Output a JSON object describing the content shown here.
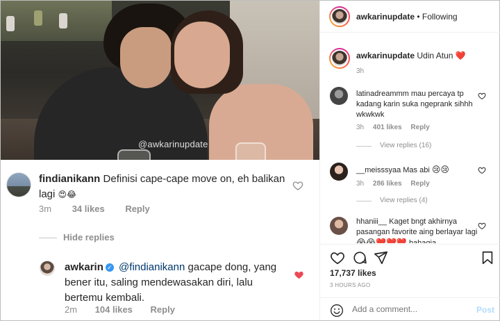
{
  "photo": {
    "watermark": "@awkarinupdate"
  },
  "zoom_comments": [
    {
      "username": "findianikann",
      "text": "Definisi cape-cape move on, eh balikan lagi",
      "emoji": "😍😂",
      "time": "3m",
      "likes": "34 likes",
      "reply": "Reply",
      "liked": false
    },
    {
      "username": "awkarin",
      "verified": true,
      "mention": "@findianikann",
      "text": "gacape dong, yang bener itu, saling mendewasakan diri, lalu bertemu kembali.",
      "time": "2m",
      "likes": "104 likes",
      "reply": "Reply",
      "liked": true
    }
  ],
  "hide_replies": "Hide replies",
  "post": {
    "account": "awkarinupdate",
    "follow_status": "• Following",
    "caption_user": "awkarinupdate",
    "caption": "Udin Atun",
    "caption_emoji": "❤️",
    "caption_time": "3h",
    "comments": [
      {
        "username": "latinadreammm",
        "text": "mau percaya tp kadang karin suka ngeprank sihhh wkwkwk",
        "time": "3h",
        "likes": "401 likes",
        "reply": "Reply",
        "view_replies": "View replies (16)"
      },
      {
        "username": "__meisssyaa",
        "text": "Mas abi",
        "emoji": "😢😢",
        "time": "3h",
        "likes": "286 likes",
        "reply": "Reply",
        "view_replies": "View replies (4)"
      },
      {
        "username": "hhaniii__",
        "text": "Kaget bngt akhirnya pasangan favorite aing berlayar lagi",
        "emoji": "😭😭❤️❤️❤️",
        "tail": "bahagia"
      }
    ],
    "likes": "17,737 likes",
    "time_ago": "3 HOURS AGO",
    "add_comment_placeholder": "Add a comment...",
    "post_button": "Post"
  },
  "colors": {
    "link": "#00376b",
    "heart_red": "#ed4956",
    "post_disabled": "#b3dbff",
    "meta_gray": "#8e8e8e"
  }
}
